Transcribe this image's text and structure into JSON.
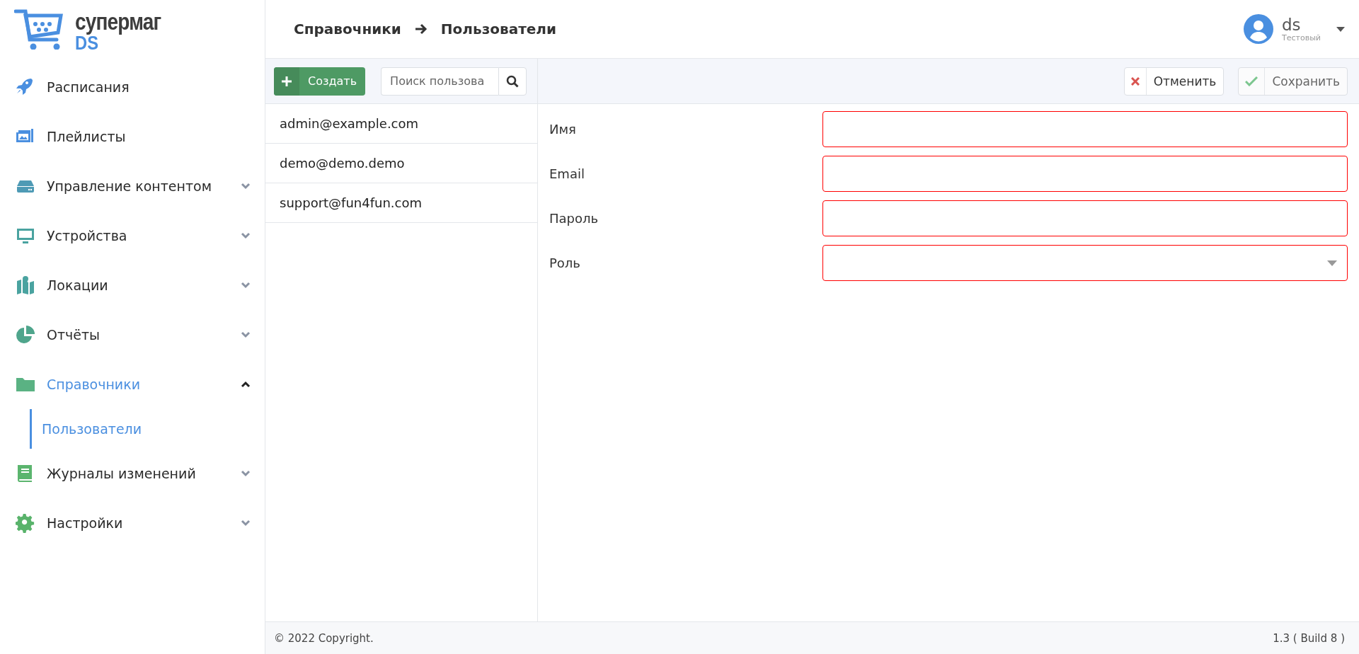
{
  "logo": {
    "title": "супермаг",
    "subtitle": "DS"
  },
  "sidebar": {
    "items": [
      {
        "label": "Расписания",
        "kind": "link",
        "selected": false
      },
      {
        "label": "Плейлисты",
        "kind": "link",
        "selected": false
      },
      {
        "label": "Управление контентом",
        "kind": "group",
        "selected": false,
        "expanded": false
      },
      {
        "label": "Устройства",
        "kind": "group",
        "selected": false,
        "expanded": false
      },
      {
        "label": "Локации",
        "kind": "group",
        "selected": false,
        "expanded": false
      },
      {
        "label": "Отчёты",
        "kind": "group",
        "selected": false,
        "expanded": false
      },
      {
        "label": "Справочники",
        "kind": "group",
        "selected": true,
        "expanded": true,
        "children": [
          {
            "label": "Пользователи",
            "selected": true
          }
        ]
      },
      {
        "label": "Журналы изменений",
        "kind": "group",
        "selected": false,
        "expanded": false
      },
      {
        "label": "Настройки",
        "kind": "group",
        "selected": false,
        "expanded": false
      }
    ]
  },
  "breadcrumb": [
    "Справочники",
    "Пользователи"
  ],
  "user": {
    "name": "ds",
    "role": "Тестовый"
  },
  "toolbar": {
    "create_button": "Создать",
    "search": {
      "placeholder": "Поиск пользова"
    },
    "cancel_button": "Отменить",
    "save_button": "Сохранить"
  },
  "users": [
    {
      "email": "admin@example.com",
      "selected": false
    },
    {
      "email": "demo@demo.demo",
      "selected": false
    },
    {
      "email": "support@fun4fun.com",
      "selected": false
    }
  ],
  "form": {
    "fields": [
      {
        "label": "Имя",
        "kind": "text",
        "invalid": true
      },
      {
        "label": "Email",
        "kind": "text",
        "invalid": true
      },
      {
        "label": "Пароль",
        "kind": "password",
        "invalid": true
      },
      {
        "label": "Роль",
        "kind": "select",
        "invalid": true
      }
    ]
  },
  "footer": {
    "copyright": "© 2022 Copyright.",
    "version": "1.3 ( Build 8 )"
  }
}
